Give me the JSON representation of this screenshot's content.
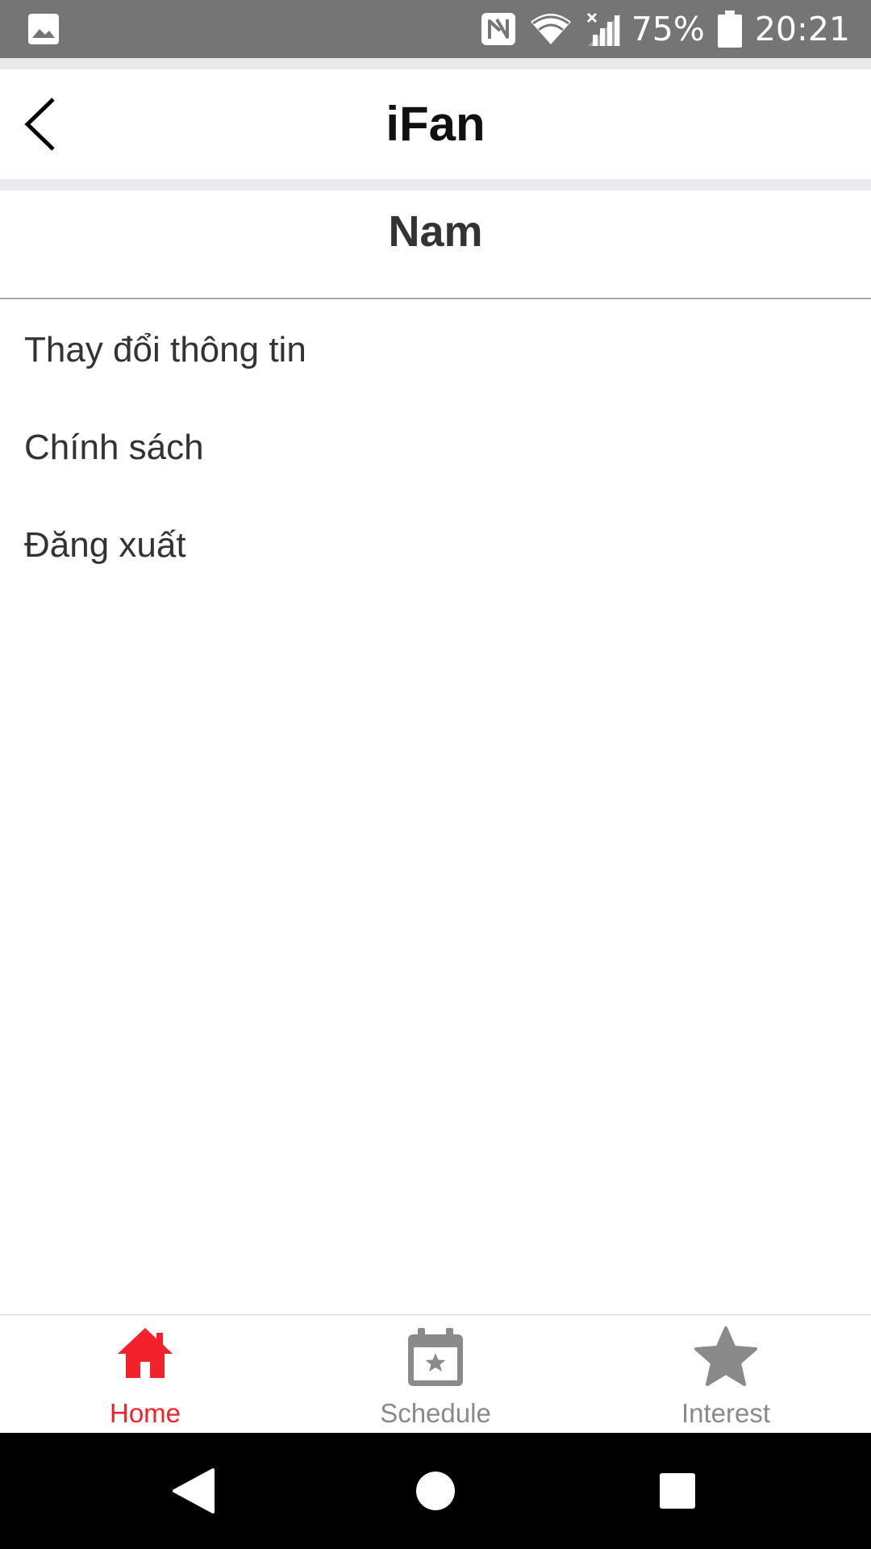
{
  "status_bar": {
    "battery_percent": "75%",
    "time": "20:21",
    "icons": [
      "gallery-icon",
      "nfc-icon",
      "wifi-icon",
      "cell-signal-icon",
      "battery-icon"
    ]
  },
  "header": {
    "title": "iFan",
    "back_icon": "chevron-left-icon"
  },
  "profile": {
    "name": "Nam"
  },
  "menu": {
    "items": [
      {
        "label": "Thay đổi thông tin"
      },
      {
        "label": "Chính sách"
      },
      {
        "label": "Đăng xuất"
      }
    ]
  },
  "tab_bar": {
    "active_color": "#f3222a",
    "inactive_color": "#8a8a8a",
    "tabs": [
      {
        "label": "Home",
        "icon": "home-icon",
        "active": true
      },
      {
        "label": "Schedule",
        "icon": "calendar-star-icon",
        "active": false
      },
      {
        "label": "Interest",
        "icon": "star-icon",
        "active": false
      }
    ]
  },
  "nav_bar": {
    "buttons": [
      "back-triangle-icon",
      "home-circle-icon",
      "recents-square-icon"
    ]
  }
}
